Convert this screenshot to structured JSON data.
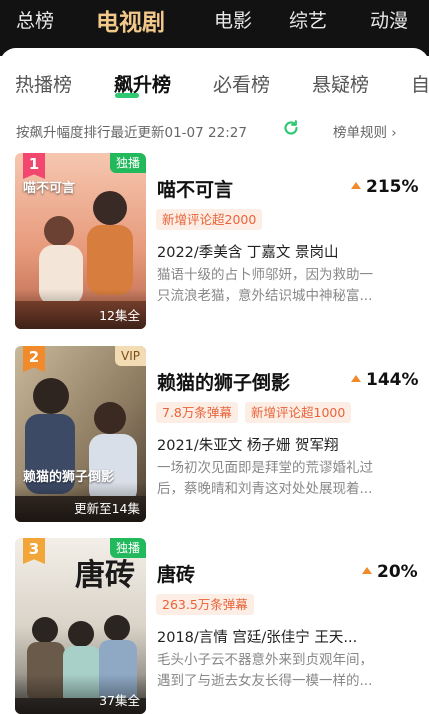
{
  "categories": [
    "总榜",
    "电视剧",
    "电影",
    "综艺",
    "动漫"
  ],
  "tabs": [
    "热播榜",
    "飙升榜",
    "必看榜",
    "悬疑榜",
    "自"
  ],
  "sort_text": "按飙升幅度排行最近更新01-07 22:27",
  "rules_text": "榜单规则 ›",
  "colors": {
    "accent_green": "#2fc873",
    "trend_orange": "#f08a2a",
    "badge_text": "#e9633a",
    "category_active": "#f2c98a"
  },
  "items": [
    {
      "rank": "1",
      "tag": "独播",
      "episodes": "12集全",
      "poster_title": "喵不可言",
      "title": "喵不可言",
      "trend": "215%",
      "badges": [
        "新增评论超2000"
      ],
      "meta": "2022/季美含 丁嘉文 景岗山",
      "desc": [
        "猫语十级的占卜师邬妍，因为救助一",
        "只流浪老猫，意外结识城中神秘富..."
      ]
    },
    {
      "rank": "2",
      "tag": "VIP",
      "episodes": "更新至14集",
      "poster_title": "赖猫的狮子倒影",
      "title": "赖猫的狮子倒影",
      "trend": "144%",
      "badges": [
        "7.8万条弹幕",
        "新增评论超1000"
      ],
      "meta": "2021/朱亚文 杨子姗 贺军翔",
      "desc": [
        "一场初次见面即是拜堂的荒谬婚礼过",
        "后，蔡晚晴和刘青这对处处展现着..."
      ]
    },
    {
      "rank": "3",
      "tag": "独播",
      "episodes": "37集全",
      "poster_title": "唐砖",
      "title": "唐砖",
      "trend": "20%",
      "badges": [
        "263.5万条弹幕"
      ],
      "meta": "2018/言情 宫廷/张佳宁 王天...",
      "desc": [
        "毛头小子云不器意外来到贞观年间，",
        "遇到了与逝去女友长得一模一样的..."
      ]
    }
  ]
}
